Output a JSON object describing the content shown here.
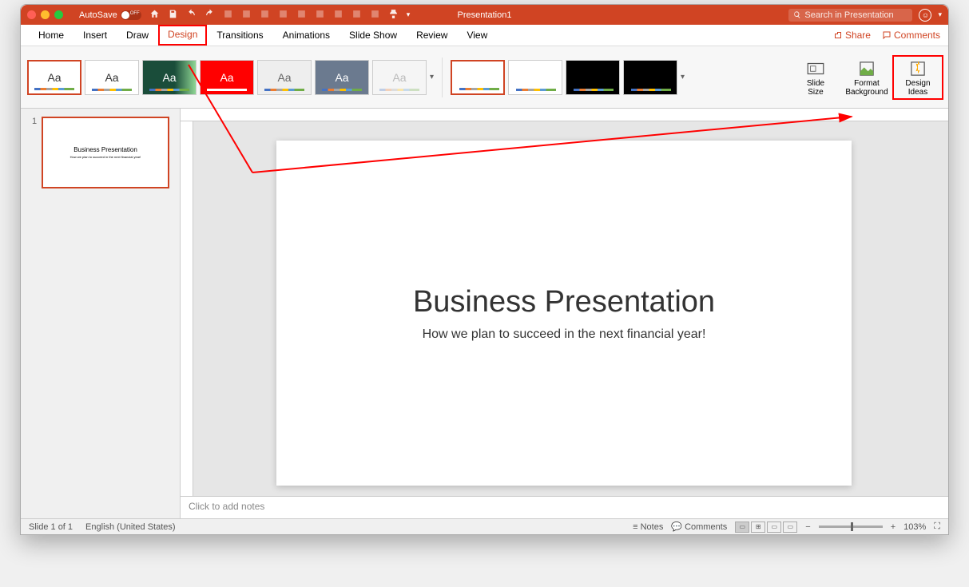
{
  "titlebar": {
    "autosave_label": "AutoSave",
    "doc_title": "Presentation1",
    "search_placeholder": "Search in Presentation"
  },
  "tabs": {
    "home": "Home",
    "insert": "Insert",
    "draw": "Draw",
    "design": "Design",
    "transitions": "Transitions",
    "animations": "Animations",
    "slideshow": "Slide Show",
    "review": "Review",
    "view": "View",
    "share": "Share",
    "comments": "Comments"
  },
  "ribbon": {
    "slide_size": "Slide\nSize",
    "format_bg": "Format\nBackground",
    "design_ideas": "Design\nIdeas"
  },
  "thumbnail": {
    "num": "1",
    "title": "Business Presentation",
    "sub": "How we plan to succeed in the next financial year!"
  },
  "slide": {
    "title": "Business Presentation",
    "subtitle": "How we plan to succeed in the next financial year!"
  },
  "notes": {
    "placeholder": "Click to add notes"
  },
  "statusbar": {
    "slide_count": "Slide 1 of 1",
    "language": "English (United States)",
    "notes": "Notes",
    "comments": "Comments",
    "zoom": "103%"
  }
}
